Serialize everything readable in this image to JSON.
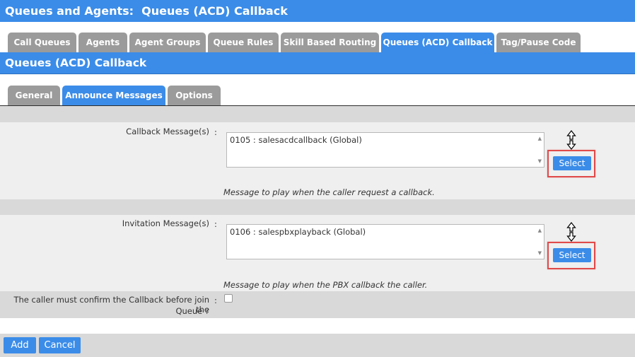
{
  "header": {
    "title": "Queues and Agents:  Queues (ACD) Callback"
  },
  "tabs": [
    {
      "label": "Call Queues"
    },
    {
      "label": "Agents"
    },
    {
      "label": "Agent Groups"
    },
    {
      "label": "Queue Rules"
    },
    {
      "label": "Skill Based Routing"
    },
    {
      "label": "Queues (ACD) Callback",
      "active": true
    },
    {
      "label": "Tag/Pause Code"
    }
  ],
  "section": {
    "title": "Queues (ACD) Callback"
  },
  "subtabs": [
    {
      "label": "General"
    },
    {
      "label": "Announce Messages",
      "active": true
    },
    {
      "label": "Options"
    }
  ],
  "form": {
    "colon": ":",
    "callback": {
      "label": "Callback Message(s)",
      "value": "0105 : salesacdcallback (Global)",
      "select_label": "Select",
      "hint": "Message to play when the caller request a callback."
    },
    "invitation": {
      "label": "Invitation Message(s)",
      "value": "0106 : salespbxplayback (Global)",
      "select_label": "Select",
      "hint": "Message to play when the PBX callback the caller."
    },
    "confirm": {
      "label_line1": "The caller must confirm the Callback before join the",
      "label_line2": "Queue ?",
      "checked": false
    }
  },
  "footer": {
    "add_label": "Add",
    "cancel_label": "Cancel"
  },
  "colors": {
    "accent": "#3b8ce8",
    "tab_inactive": "#9b9b9b",
    "highlight": "#e04a4a"
  },
  "icons": {
    "sort": "sort-arrows-icon"
  }
}
